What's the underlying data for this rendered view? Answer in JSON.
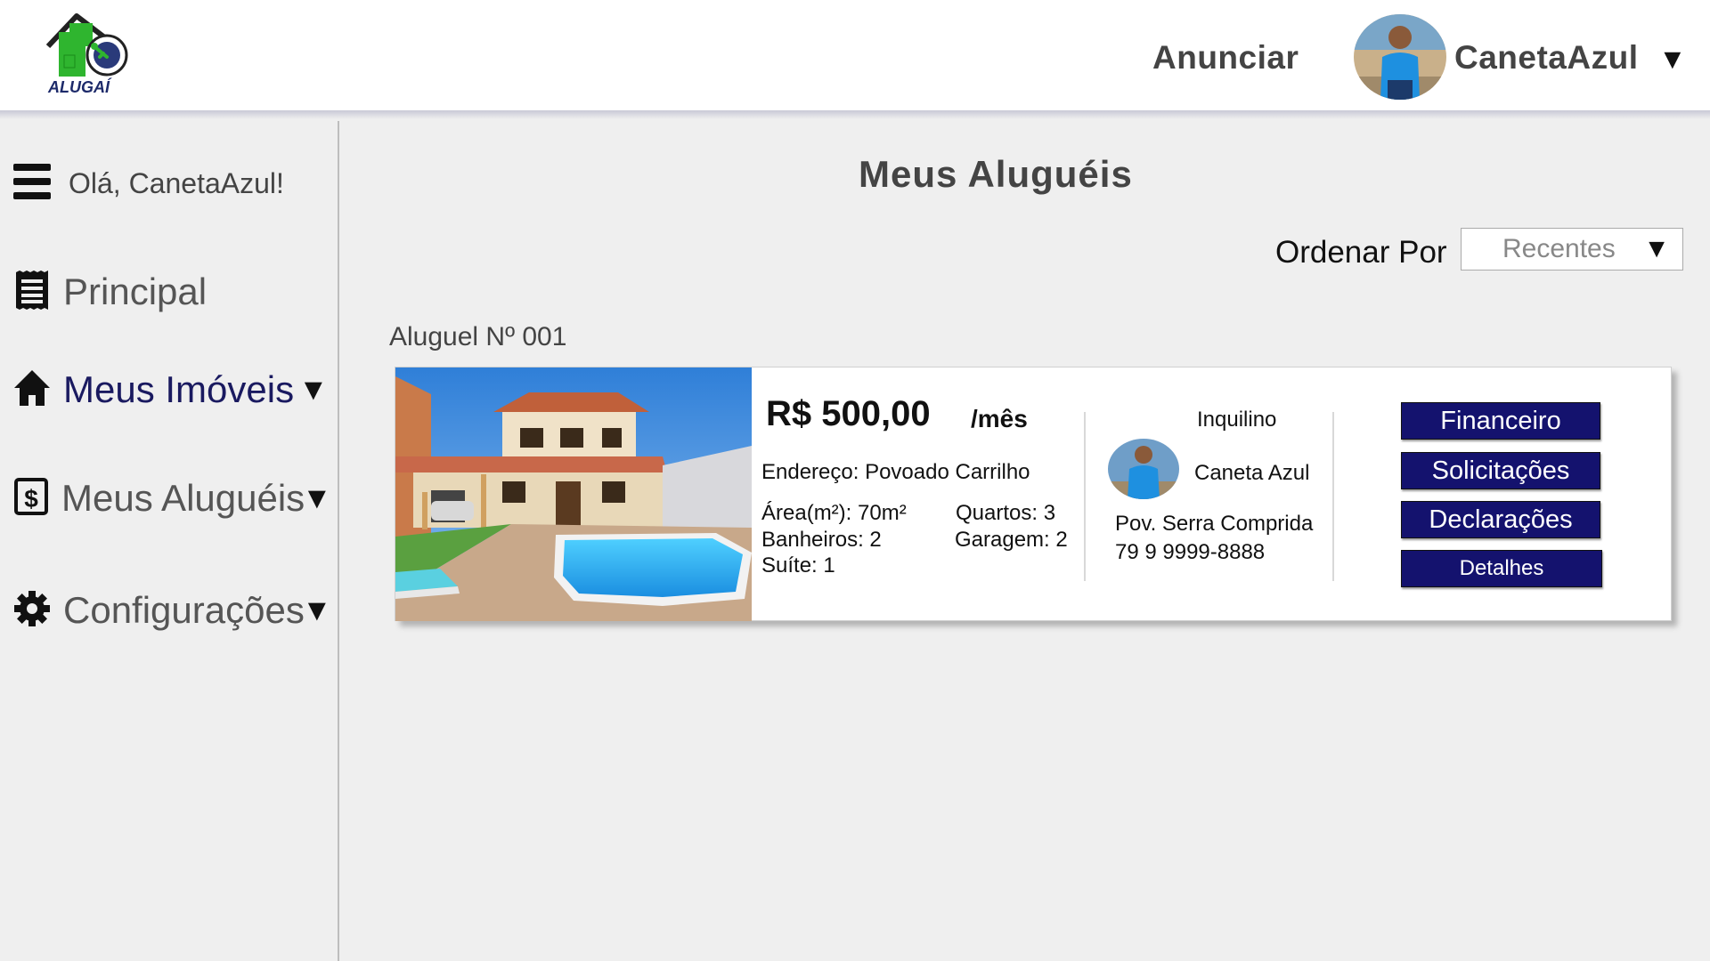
{
  "header": {
    "logo_text": "ALUGAÍ",
    "anunciar_label": "Anunciar",
    "user_name": "CanetaAzul",
    "user_caret": "▼"
  },
  "sidebar": {
    "greeting": "Olá, CanetaAzul!",
    "items": [
      {
        "label": "Principal",
        "icon": "receipt-icon",
        "caret": ""
      },
      {
        "label": "Meus Imóveis",
        "icon": "home-icon",
        "caret": "▼"
      },
      {
        "label": "Meus Aluguéis",
        "icon": "dollar-document-icon",
        "caret": "▼"
      },
      {
        "label": "Configurações",
        "icon": "gear-icon",
        "caret": "▼"
      }
    ]
  },
  "main": {
    "title": "Meus Aluguéis",
    "sort": {
      "label": "Ordenar Por",
      "value": "Recentes",
      "caret": "▼"
    },
    "rental": {
      "label": "Aluguel Nº 001",
      "price": "R$ 500,00",
      "per": "/mês",
      "address": "Endereço: Povoado Carrilho",
      "area": "Área(m²): 70m²",
      "bathrooms": "Banheiros: 2",
      "suite": "Suíte: 1",
      "bedrooms": "Quartos: 3",
      "garage": "Garagem: 2",
      "tenant": {
        "title": "Inquilino",
        "name": "Caneta Azul",
        "address": "Pov. Serra Comprida",
        "phone": "79 9 9999-8888"
      },
      "buttons": {
        "financeiro": "Financeiro",
        "solicitacoes": "Solicitações",
        "declaracoes": "Declarações",
        "detalhes": "Detalhes"
      }
    }
  },
  "colors": {
    "accent_navy": "#14126e",
    "logo_green": "#2fb52f",
    "active_nav": "#1a1a60"
  }
}
